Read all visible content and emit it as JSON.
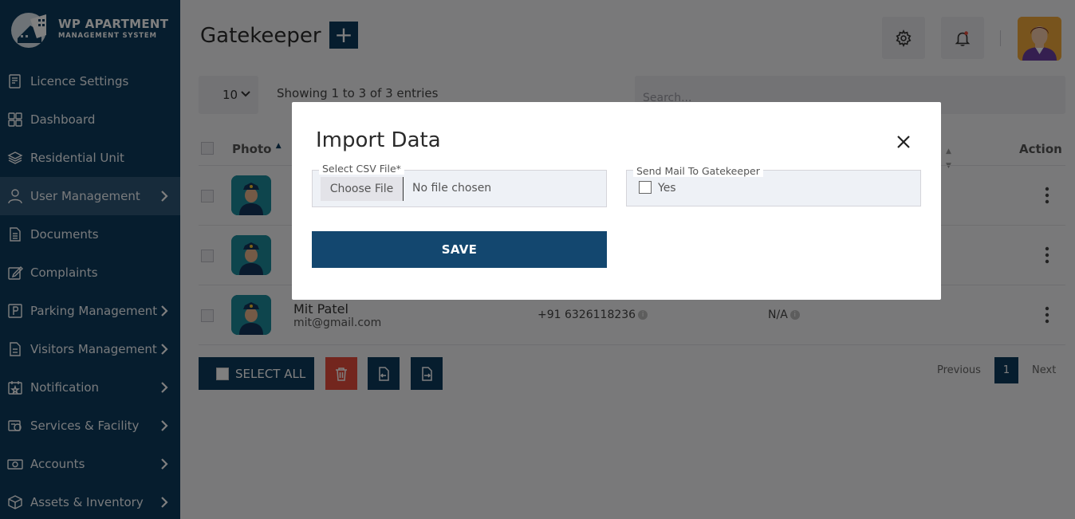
{
  "colors": {
    "sidebar_bg": "#0d3a5c",
    "accent": "#0d3a5c",
    "save_bg": "#13476f",
    "danger": "#e74c3c",
    "active_item": "#2f5676"
  },
  "brand": {
    "title": "WP APARTMENT",
    "subtitle": "MANAGEMENT SYSTEM"
  },
  "sidebar": {
    "items": [
      {
        "label": "Licence Settings",
        "icon": "licence-icon",
        "chevron": false,
        "active": false
      },
      {
        "label": "Dashboard",
        "icon": "dashboard-icon",
        "chevron": false,
        "active": false
      },
      {
        "label": "Residential Unit",
        "icon": "layers-icon",
        "chevron": false,
        "active": false
      },
      {
        "label": "User Management",
        "icon": "user-icon",
        "chevron": true,
        "active": true
      },
      {
        "label": "Documents",
        "icon": "document-icon",
        "chevron": false,
        "active": false
      },
      {
        "label": "Complaints",
        "icon": "edit-icon",
        "chevron": false,
        "active": false
      },
      {
        "label": "Parking Management",
        "icon": "parking-icon",
        "chevron": true,
        "active": false
      },
      {
        "label": "Visitors Management",
        "icon": "visitors-icon",
        "chevron": true,
        "active": false
      },
      {
        "label": "Notification",
        "icon": "calendar-star-icon",
        "chevron": true,
        "active": false
      },
      {
        "label": "Services & Facility",
        "icon": "service-icon",
        "chevron": true,
        "active": false
      },
      {
        "label": "Accounts",
        "icon": "money-icon",
        "chevron": true,
        "active": false
      },
      {
        "label": "Assets & Inventory",
        "icon": "box-icon",
        "chevron": true,
        "active": false
      }
    ]
  },
  "header": {
    "title": "Gatekeeper",
    "add_label": "+"
  },
  "table": {
    "page_length": "10",
    "info": "Showing 1 to 3 of 3 entries",
    "search_placeholder": "Search...",
    "columns": {
      "photo": "Photo",
      "action": "Action"
    },
    "visible_row": {
      "name": "Mit Patel",
      "email": "mit@gmail.com",
      "phone": "+91 6326118236",
      "extra": "N/A"
    }
  },
  "footer": {
    "select_all": "SELECT ALL",
    "previous": "Previous",
    "page": "1",
    "next": "Next"
  },
  "modal": {
    "title": "Import Data",
    "csv_label": "Select CSV File*",
    "choose_file": "Choose File",
    "no_file": "No file chosen",
    "mail_label": "Send Mail To Gatekeeper",
    "mail_option": "Yes",
    "mail_checked": false,
    "save": "SAVE"
  }
}
